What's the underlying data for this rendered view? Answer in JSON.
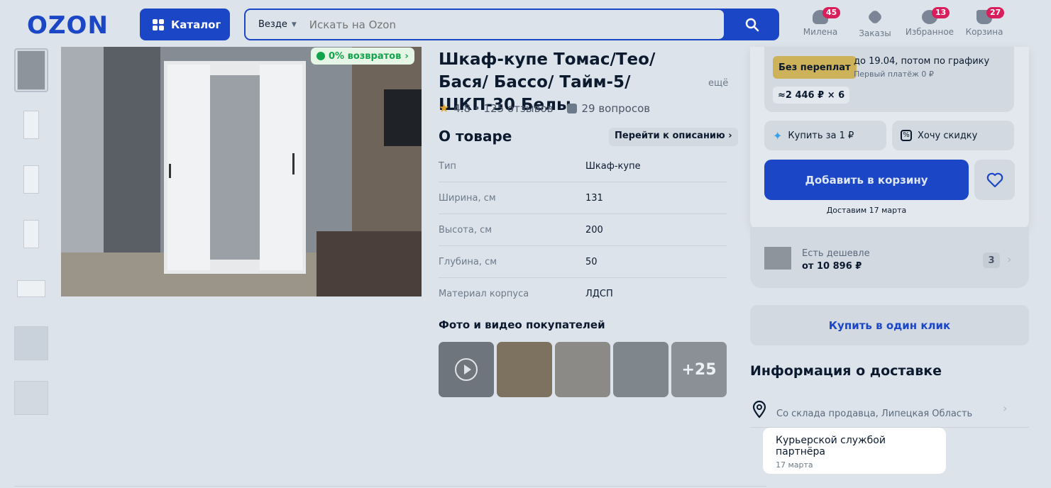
{
  "header": {
    "logo": "OZON",
    "catalog_label": "Каталог",
    "search_scope": "Везде",
    "search_placeholder": "Искать на Ozon",
    "icons": [
      {
        "label": "Милена",
        "badge": "45",
        "icon": "user-icon"
      },
      {
        "label": "Заказы",
        "badge": "",
        "icon": "box-icon"
      },
      {
        "label": "Избранное",
        "badge": "13",
        "icon": "heart-icon"
      },
      {
        "label": "Корзина",
        "badge": "27",
        "icon": "cart-icon"
      }
    ]
  },
  "gallery": {
    "return_badge": "0% возвратов"
  },
  "product": {
    "title": "Шкаф-купе Томас/Тео/ Бася/ Бассо/ Тайм-5/ ШКП-30 Белы",
    "more_label": "ещё",
    "rating": "4.8 • 125 отзывов",
    "questions": "29 вопросов",
    "about_title": "О товаре",
    "goto_description": "Перейти к описанию ›",
    "specs": [
      {
        "key": "Тип",
        "value": "Шкаф-купе"
      },
      {
        "key": "Ширина, см",
        "value": "131"
      },
      {
        "key": "Высота, см",
        "value": "200"
      },
      {
        "key": "Глубина, см",
        "value": "50"
      },
      {
        "key": "Материал корпуса",
        "value": "ЛДСП"
      }
    ],
    "photos_title": "Фото и видео покупателей",
    "photos_more": "+25"
  },
  "buy": {
    "no_overpay": "Без переплат",
    "installment_until": "до 19.04, потом по графику",
    "first_payment": "Первый платёж 0 ₽",
    "installment_calc": "≈2 446 ₽ × 6",
    "buy_for_1": "Купить за 1 ₽",
    "want_discount": "Хочу скидку",
    "add_to_cart": "Добавить в корзину",
    "delivery_date": "Доставим 17 марта"
  },
  "cheaper": {
    "label": "Есть дешевле",
    "price": "от 10 896 ₽",
    "count": "3"
  },
  "one_click": "Купить в один клик",
  "delivery": {
    "title": "Информация о доставке",
    "warehouse": "Со склада продавца, Липецкая Область",
    "courier": "Курьерской службой партнёра",
    "courier_date": "17 марта"
  },
  "colors": {
    "brand": "#1b47c7",
    "badge": "#d81e5b",
    "return_green": "#12a44c"
  }
}
